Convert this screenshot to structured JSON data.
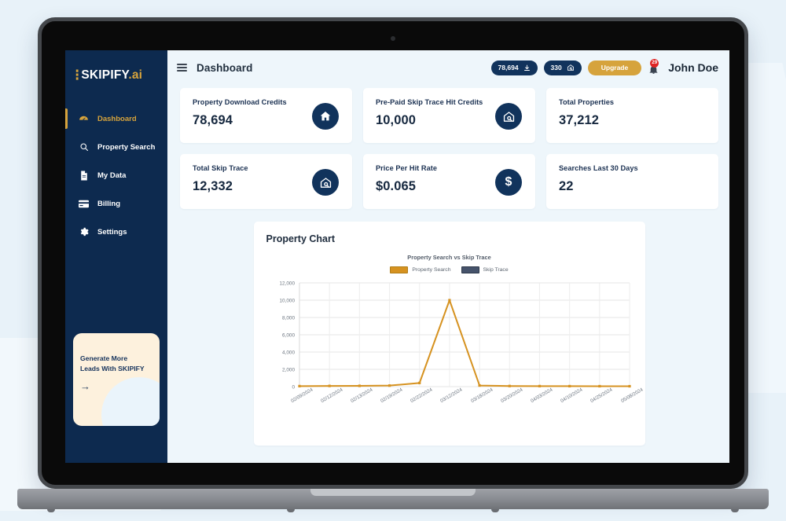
{
  "app": {
    "brand_mark": "∴",
    "brand_name": "SKIPIFY",
    "brand_suffix": ".ai",
    "page_title": "Dashboard"
  },
  "sidebar": {
    "items": [
      {
        "label": "Dashboard",
        "icon": "speedometer-icon",
        "active": true
      },
      {
        "label": "Property Search",
        "icon": "search-icon",
        "active": false
      },
      {
        "label": "My Data",
        "icon": "document-icon",
        "active": false
      },
      {
        "label": "Billing",
        "icon": "credit-card-icon",
        "active": false
      },
      {
        "label": "Settings",
        "icon": "gear-icon",
        "active": false
      }
    ],
    "promo": {
      "line1": "Generate More",
      "line2": "Leads With SKIPIFY",
      "arrow": "→"
    }
  },
  "topbar": {
    "menu_icon": "hamburger-icon",
    "credits_pill": {
      "value": "78,694",
      "icon": "download-icon"
    },
    "properties_pill": {
      "value": "330",
      "icon": "house-search-icon"
    },
    "upgrade_label": "Upgrade",
    "notifications": {
      "icon": "bell-icon",
      "count": "29"
    },
    "username": "John Doe"
  },
  "cards": [
    {
      "label": "Property Download Credits",
      "value": "78,694",
      "icon": "house-icon"
    },
    {
      "label": "Pre-Paid Skip Trace Hit Credits",
      "value": "10,000",
      "icon": "house-search-icon"
    },
    {
      "label": "Total Properties",
      "value": "37,212",
      "icon": "none"
    },
    {
      "label": "Total Skip Trace",
      "value": "12,332",
      "icon": "house-search-icon"
    },
    {
      "label": "Price Per Hit Rate",
      "value": "$0.065",
      "icon": "dollar-icon"
    },
    {
      "label": "Searches Last 30 Days",
      "value": "22",
      "icon": "none"
    }
  ],
  "chart_panel": {
    "heading": "Property Chart"
  },
  "chart_data": {
    "type": "line",
    "title": "Property Search vs Skip Trace",
    "xlabel": "",
    "ylabel": "",
    "ylim": [
      0,
      12000
    ],
    "yticks": [
      "0",
      "2,000",
      "4,000",
      "6,000",
      "8,000",
      "10,000",
      "12,000"
    ],
    "ytick_values": [
      0,
      2000,
      4000,
      6000,
      8000,
      10000,
      12000
    ],
    "grid": true,
    "legend_position": "top-center",
    "categories": [
      "02/09/2024",
      "02/12/2024",
      "02/13/2024",
      "02/19/2024",
      "02/22/2024",
      "03/12/2024",
      "03/18/2024",
      "03/20/2024",
      "04/03/2024",
      "04/10/2024",
      "04/25/2024",
      "05/08/2024"
    ],
    "series": [
      {
        "name": "Property Search",
        "color": "#d69220",
        "values": [
          60,
          80,
          90,
          120,
          420,
          10000,
          130,
          70,
          60,
          55,
          50,
          45
        ]
      },
      {
        "name": "Skip Trace",
        "color": "#46536b",
        "values": [
          0,
          0,
          0,
          0,
          0,
          0,
          0,
          0,
          0,
          0,
          0,
          0
        ]
      }
    ]
  },
  "colors": {
    "brand_navy": "#0d2a4f",
    "brand_gold": "#d6a33c",
    "page_bg": "#eef6fb",
    "badge_red": "#e02424"
  }
}
